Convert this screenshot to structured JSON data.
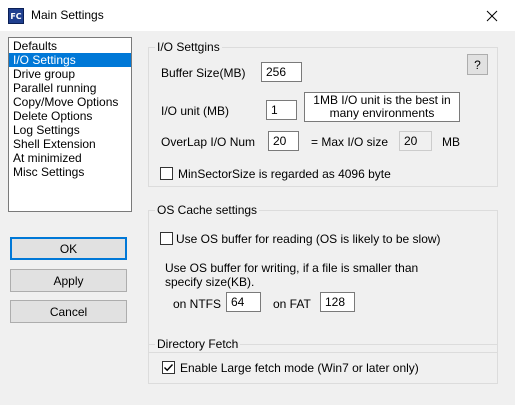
{
  "window": {
    "title": "Main Settings",
    "icon_text": "FC",
    "close_glyph": "✕"
  },
  "sidebar": {
    "items": [
      {
        "label": "Defaults",
        "selected": false
      },
      {
        "label": "I/O Settings",
        "selected": true
      },
      {
        "label": "Drive group",
        "selected": false
      },
      {
        "label": "Parallel running",
        "selected": false
      },
      {
        "label": "Copy/Move Options",
        "selected": false
      },
      {
        "label": "Delete Options",
        "selected": false
      },
      {
        "label": "Log Settings",
        "selected": false
      },
      {
        "label": "Shell Extension",
        "selected": false
      },
      {
        "label": "At minimized",
        "selected": false
      },
      {
        "label": "Misc Settings",
        "selected": false
      }
    ]
  },
  "buttons": {
    "ok": "OK",
    "apply": "Apply",
    "cancel": "Cancel",
    "help": "?"
  },
  "io_group": {
    "title": "I/O Settgins",
    "buffer_size_label": "Buffer Size(MB)",
    "buffer_size_value": "256",
    "io_unit_label": "I/O unit (MB)",
    "io_unit_value": "1",
    "io_unit_note_line1": "1MB I/O unit is the best in",
    "io_unit_note_line2": "many environments",
    "overlap_label": "OverLap I/O Num",
    "overlap_value": "20",
    "max_io_label": "= Max I/O size",
    "max_io_value": "20",
    "max_io_unit": "MB",
    "minsector_label": "MinSectorSize is regarded as 4096 byte",
    "minsector_checked": false
  },
  "os_cache_group": {
    "title": "OS Cache settings",
    "read_buffer_label": "Use OS buffer for reading (OS is likely to be slow)",
    "read_buffer_checked": false,
    "write_text_line1": "Use OS buffer for writing, if a file is smaller than",
    "write_text_line2": "specify size(KB).",
    "ntfs_label": "on NTFS",
    "ntfs_value": "64",
    "fat_label": "on FAT",
    "fat_value": "128"
  },
  "dir_fetch_group": {
    "title": "Directory Fetch",
    "large_fetch_label": "Enable Large fetch mode (Win7 or later only)",
    "large_fetch_checked": true
  }
}
